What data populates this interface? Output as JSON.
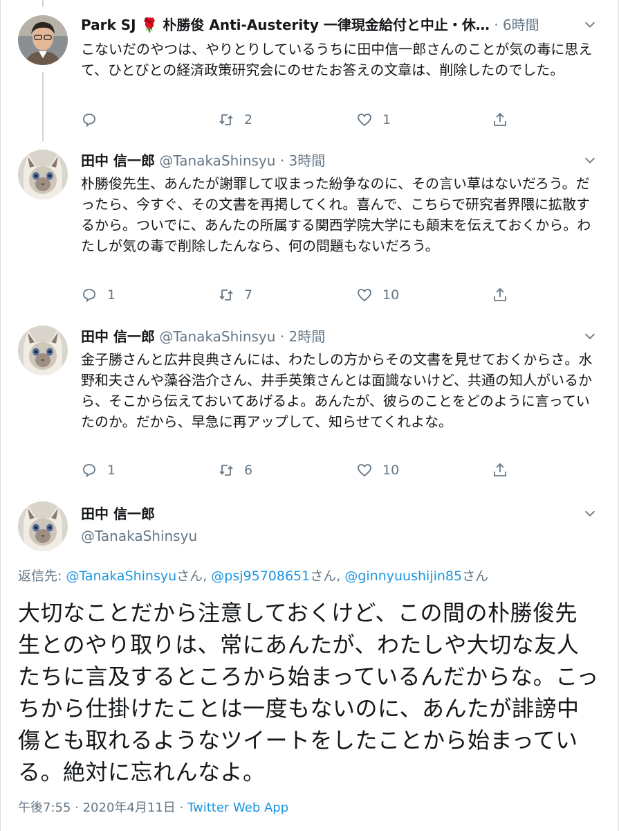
{
  "tweets": [
    {
      "name": "Park SJ 🌹 朴勝俊 Anti-Austerity 一律現金給付と中止・休…",
      "handle": "",
      "time": "6時間",
      "text": "こないだのやつは、やりとりしているうちに田中信一郎さんのことが気の毒に思えて、ひとびとの経済政策研究会にのせたお答えの文章は、削除したのでした。",
      "reply_count": "",
      "retweet_count": "2",
      "like_count": "1"
    },
    {
      "name": "田中 信一郎",
      "handle": "@TanakaShinsyu",
      "time": "3時間",
      "text": "朴勝俊先生、あんたが謝罪して収まった紛争なのに、その言い草はないだろう。だったら、今すぐ、その文書を再掲してくれ。喜んで、こちらで研究者界隈に拡散するから。ついでに、あんたの所属する関西学院大学にも顛末を伝えておくから。わたしが気の毒で削除したんなら、何の問題もないだろう。",
      "reply_count": "1",
      "retweet_count": "7",
      "like_count": "10"
    },
    {
      "name": "田中 信一郎",
      "handle": "@TanakaShinsyu",
      "time": "2時間",
      "text": "金子勝さんと広井良典さんには、わたしの方からその文書を見せておくからさ。水野和夫さんや藻谷浩介さん、井手英策さんとは面識ないけど、共通の知人がいるから、そこから伝えておいてあげるよ。あんたが、彼らのことをどのように言っていたのか。だから、早急に再アップして、知らせてくれよな。",
      "reply_count": "1",
      "retweet_count": "6",
      "like_count": "10"
    }
  ],
  "main_tweet": {
    "name": "田中 信一郎",
    "handle": "@TanakaShinsyu",
    "reply_prefix": "返信先: ",
    "mentions": [
      "@TanakaShinsyu",
      "@psj95708651",
      "@ginnyuushijin85"
    ],
    "mention_suffix": "さん",
    "separator": ", ",
    "text": "大切なことだから注意しておくけど、この間の朴勝俊先生とのやり取りは、常にあんたが、わたしや大切な友人たちに言及するところから始まっているんだからな。こっちから仕掛けたことは一度もないのに、あんたが誹謗中傷とも取れるようなツイートをしたことから始まっている。絶対に忘れんなよ。",
    "time": "午後7:55",
    "date": "2020年4月11日",
    "app": "Twitter Web App"
  },
  "colors": {
    "text": "#14171a",
    "secondary": "#657786",
    "link": "#1b95e0",
    "thread_line": "#ccd6dd",
    "rose": "#c0182b"
  },
  "icons": [
    "reply-icon",
    "retweet-icon",
    "like-icon",
    "share-icon",
    "chevron-down-icon",
    "rose-emoji"
  ]
}
